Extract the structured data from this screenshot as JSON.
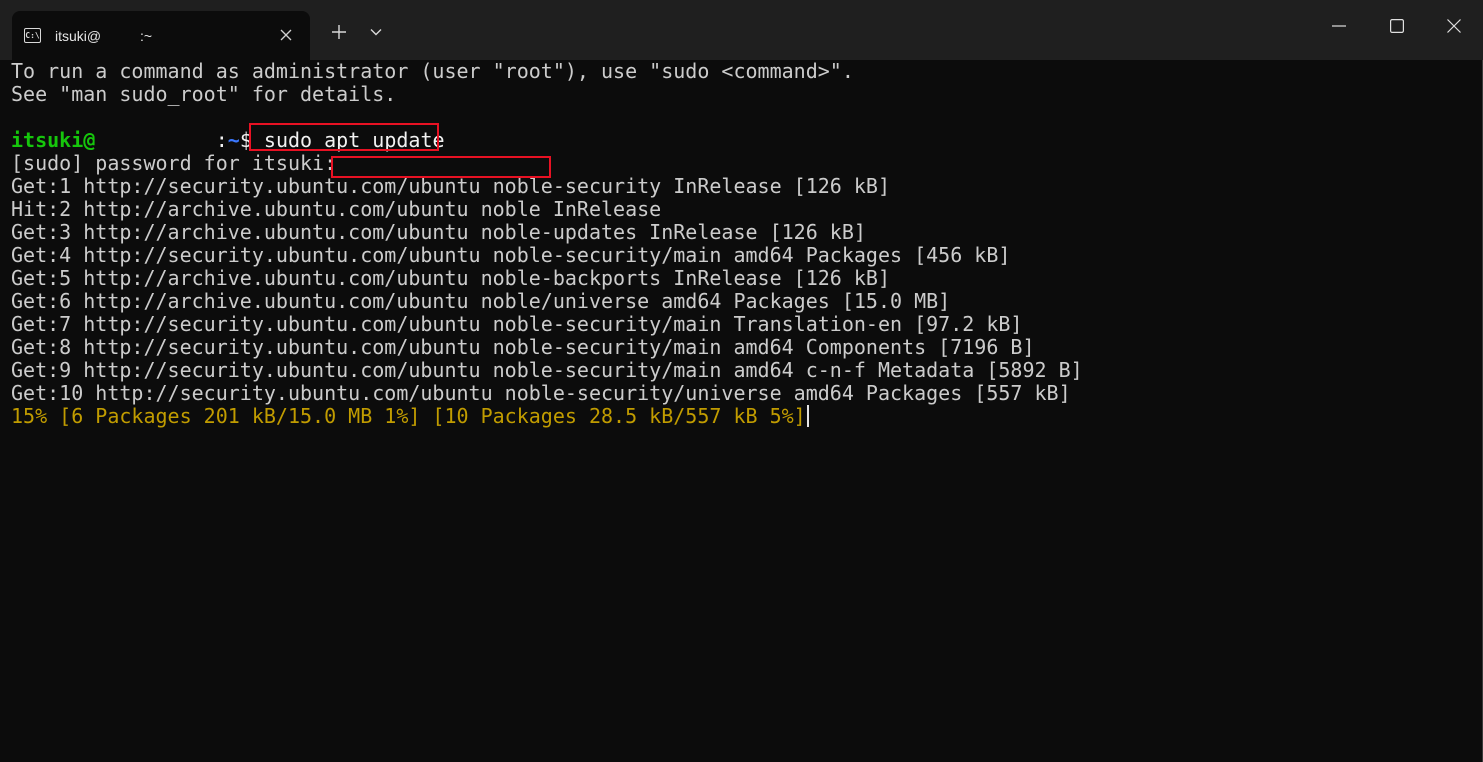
{
  "tab": {
    "title": "itsuki@          :~",
    "icon": "terminal-icon"
  },
  "titlebar": {
    "new_tab": "+",
    "colors": {
      "bg": "#1f1f1f",
      "tab_bg": "#0c0c0c"
    }
  },
  "terminal": {
    "intro": [
      "To run a command as administrator (user \"root\"), use \"sudo <command>\".",
      "See \"man sudo_root\" for details."
    ],
    "prompt": {
      "user": "itsuki@",
      "host_gap": "          ",
      "sep": ":",
      "path": "~",
      "symbol": "$ ",
      "command": "sudo apt update"
    },
    "password_prompt": "[sudo] password for itsuki:",
    "output": [
      "Get:1 http://security.ubuntu.com/ubuntu noble-security InRelease [126 kB]",
      "Hit:2 http://archive.ubuntu.com/ubuntu noble InRelease",
      "Get:3 http://archive.ubuntu.com/ubuntu noble-updates InRelease [126 kB]",
      "Get:4 http://security.ubuntu.com/ubuntu noble-security/main amd64 Packages [456 kB]",
      "Get:5 http://archive.ubuntu.com/ubuntu noble-backports InRelease [126 kB]",
      "Get:6 http://archive.ubuntu.com/ubuntu noble/universe amd64 Packages [15.0 MB]",
      "Get:7 http://security.ubuntu.com/ubuntu noble-security/main Translation-en [97.2 kB]",
      "Get:8 http://security.ubuntu.com/ubuntu noble-security/main amd64 Components [7196 B]",
      "Get:9 http://security.ubuntu.com/ubuntu noble-security/main amd64 c-n-f Metadata [5892 B]",
      "Get:10 http://security.ubuntu.com/ubuntu noble-security/universe amd64 Packages [557 kB]"
    ],
    "progress": "15% [6 Packages 201 kB/15.0 MB 1%] [10 Packages 28.5 kB/557 kB 5%]",
    "colors": {
      "fg": "#cccccc",
      "user": "#16c60c",
      "path": "#3b78ff",
      "progress": "#c19c00",
      "highlight": "#e81123"
    }
  }
}
